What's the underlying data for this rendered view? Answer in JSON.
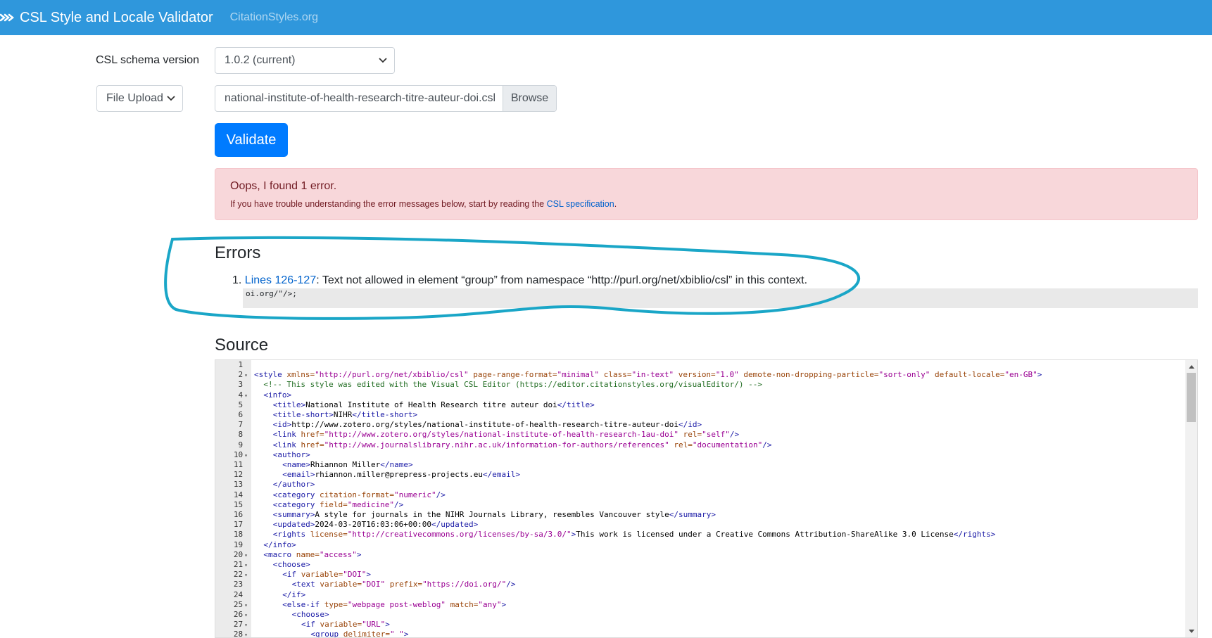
{
  "colors": {
    "nav_bg": "#2f97dc",
    "validate_bg": "#007bff",
    "alert_bg": "#f8d7da",
    "annotation": "#1aa6c7"
  },
  "navbar": {
    "logo_icon": "csl-logo-icon",
    "title": "CSL Style and Locale Validator",
    "link": "CitationStyles.org"
  },
  "form": {
    "schema_label": "CSL schema version",
    "schema_value": "1.0.2 (current)",
    "upload_mode": "File Upload",
    "file_name": "national-institute-of-health-research-titre-auteur-doi.csl",
    "browse_label": "Browse",
    "validate_label": "Validate"
  },
  "alert": {
    "title": "Oops, I found 1 error.",
    "text_before": "If you have trouble understanding the error messages below, start by reading the ",
    "link": "CSL specification",
    "text_after": "."
  },
  "errors": {
    "heading": "Errors",
    "items": [
      {
        "number": "1.",
        "lines_link": "Lines 126-127",
        "message": ": Text not allowed in element “group” from namespace “http://purl.org/net/xbiblio/csl” in this context.",
        "snippet": "oi.org/\"/>;"
      }
    ]
  },
  "source": {
    "heading": "Source",
    "lines": [
      {
        "n": "1",
        "fold": false,
        "indent": 0,
        "t": []
      },
      {
        "n": "2",
        "fold": true,
        "indent": 0,
        "t": [
          [
            "tag",
            "<style "
          ],
          [
            "attr",
            "xmlns="
          ],
          [
            "val",
            "\"http://purl.org/net/xbiblio/csl\""
          ],
          [
            "attr",
            " page-range-format="
          ],
          [
            "val",
            "\"minimal\""
          ],
          [
            "attr",
            " class="
          ],
          [
            "val",
            "\"in-text\""
          ],
          [
            "attr",
            " version="
          ],
          [
            "val",
            "\"1.0\""
          ],
          [
            "attr",
            " demote-non-dropping-particle="
          ],
          [
            "val",
            "\"sort-only\""
          ],
          [
            "attr",
            " default-locale="
          ],
          [
            "val",
            "\"en-GB\""
          ],
          [
            "tag",
            ">"
          ]
        ]
      },
      {
        "n": "3",
        "fold": false,
        "indent": 1,
        "t": [
          [
            "comment",
            "<!-- This style was edited with the Visual CSL Editor (https://editor.citationstyles.org/visualEditor/) -->"
          ]
        ]
      },
      {
        "n": "4",
        "fold": true,
        "indent": 1,
        "t": [
          [
            "tag",
            "<info>"
          ]
        ]
      },
      {
        "n": "5",
        "fold": false,
        "indent": 2,
        "t": [
          [
            "tag",
            "<title>"
          ],
          [
            "text",
            "National Institute of Health Research titre auteur doi"
          ],
          [
            "tag",
            "</title>"
          ]
        ]
      },
      {
        "n": "6",
        "fold": false,
        "indent": 2,
        "t": [
          [
            "tag",
            "<title-short>"
          ],
          [
            "text",
            "NIHR"
          ],
          [
            "tag",
            "</title-short>"
          ]
        ]
      },
      {
        "n": "7",
        "fold": false,
        "indent": 2,
        "t": [
          [
            "tag",
            "<id>"
          ],
          [
            "text",
            "http://www.zotero.org/styles/national-institute-of-health-research-titre-auteur-doi"
          ],
          [
            "tag",
            "</id>"
          ]
        ]
      },
      {
        "n": "8",
        "fold": false,
        "indent": 2,
        "t": [
          [
            "tag",
            "<link "
          ],
          [
            "attr",
            "href="
          ],
          [
            "val",
            "\"http://www.zotero.org/styles/national-institute-of-health-research-1au-doi\""
          ],
          [
            "attr",
            " rel="
          ],
          [
            "val",
            "\"self\""
          ],
          [
            "tag",
            "/>"
          ]
        ]
      },
      {
        "n": "9",
        "fold": false,
        "indent": 2,
        "t": [
          [
            "tag",
            "<link "
          ],
          [
            "attr",
            "href="
          ],
          [
            "val",
            "\"http://www.journalslibrary.nihr.ac.uk/information-for-authors/references\""
          ],
          [
            "attr",
            " rel="
          ],
          [
            "val",
            "\"documentation\""
          ],
          [
            "tag",
            "/>"
          ]
        ]
      },
      {
        "n": "10",
        "fold": true,
        "indent": 2,
        "t": [
          [
            "tag",
            "<author>"
          ]
        ]
      },
      {
        "n": "11",
        "fold": false,
        "indent": 3,
        "t": [
          [
            "tag",
            "<name>"
          ],
          [
            "text",
            "Rhiannon Miller"
          ],
          [
            "tag",
            "</name>"
          ]
        ]
      },
      {
        "n": "12",
        "fold": false,
        "indent": 3,
        "t": [
          [
            "tag",
            "<email>"
          ],
          [
            "text",
            "rhiannon.miller@prepress-projects.eu"
          ],
          [
            "tag",
            "</email>"
          ]
        ]
      },
      {
        "n": "13",
        "fold": false,
        "indent": 2,
        "t": [
          [
            "tag",
            "</author>"
          ]
        ]
      },
      {
        "n": "14",
        "fold": false,
        "indent": 2,
        "t": [
          [
            "tag",
            "<category "
          ],
          [
            "attr",
            "citation-format="
          ],
          [
            "val",
            "\"numeric\""
          ],
          [
            "tag",
            "/>"
          ]
        ]
      },
      {
        "n": "15",
        "fold": false,
        "indent": 2,
        "t": [
          [
            "tag",
            "<category "
          ],
          [
            "attr",
            "field="
          ],
          [
            "val",
            "\"medicine\""
          ],
          [
            "tag",
            "/>"
          ]
        ]
      },
      {
        "n": "16",
        "fold": false,
        "indent": 2,
        "t": [
          [
            "tag",
            "<summary>"
          ],
          [
            "text",
            "A style for journals in the NIHR Journals Library, resembles Vancouver style"
          ],
          [
            "tag",
            "</summary>"
          ]
        ]
      },
      {
        "n": "17",
        "fold": false,
        "indent": 2,
        "t": [
          [
            "tag",
            "<updated>"
          ],
          [
            "text",
            "2024-03-20T16:03:06+00:00"
          ],
          [
            "tag",
            "</updated>"
          ]
        ]
      },
      {
        "n": "18",
        "fold": false,
        "indent": 2,
        "t": [
          [
            "tag",
            "<rights "
          ],
          [
            "attr",
            "license="
          ],
          [
            "val",
            "\"http://creativecommons.org/licenses/by-sa/3.0/\""
          ],
          [
            "tag",
            ">"
          ],
          [
            "text",
            "This work is licensed under a Creative Commons Attribution-ShareAlike 3.0 License"
          ],
          [
            "tag",
            "</rights>"
          ]
        ]
      },
      {
        "n": "19",
        "fold": false,
        "indent": 1,
        "t": [
          [
            "tag",
            "</info>"
          ]
        ]
      },
      {
        "n": "20",
        "fold": true,
        "indent": 1,
        "t": [
          [
            "tag",
            "<macro "
          ],
          [
            "attr",
            "name="
          ],
          [
            "val",
            "\"access\""
          ],
          [
            "tag",
            ">"
          ]
        ]
      },
      {
        "n": "21",
        "fold": true,
        "indent": 2,
        "t": [
          [
            "tag",
            "<choose>"
          ]
        ]
      },
      {
        "n": "22",
        "fold": true,
        "indent": 3,
        "t": [
          [
            "tag",
            "<if "
          ],
          [
            "attr",
            "variable="
          ],
          [
            "val",
            "\"DOI\""
          ],
          [
            "tag",
            ">"
          ]
        ]
      },
      {
        "n": "23",
        "fold": false,
        "indent": 4,
        "t": [
          [
            "tag",
            "<text "
          ],
          [
            "attr",
            "variable="
          ],
          [
            "val",
            "\"DOI\""
          ],
          [
            "attr",
            " prefix="
          ],
          [
            "val",
            "\"https://doi.org/\""
          ],
          [
            "tag",
            "/>"
          ]
        ]
      },
      {
        "n": "24",
        "fold": false,
        "indent": 3,
        "t": [
          [
            "tag",
            "</if>"
          ]
        ]
      },
      {
        "n": "25",
        "fold": true,
        "indent": 3,
        "t": [
          [
            "tag",
            "<else-if "
          ],
          [
            "attr",
            "type="
          ],
          [
            "val",
            "\"webpage post-weblog\""
          ],
          [
            "attr",
            " match="
          ],
          [
            "val",
            "\"any\""
          ],
          [
            "tag",
            ">"
          ]
        ]
      },
      {
        "n": "26",
        "fold": true,
        "indent": 4,
        "t": [
          [
            "tag",
            "<choose>"
          ]
        ]
      },
      {
        "n": "27",
        "fold": true,
        "indent": 5,
        "t": [
          [
            "tag",
            "<if "
          ],
          [
            "attr",
            "variable="
          ],
          [
            "val",
            "\"URL\""
          ],
          [
            "tag",
            ">"
          ]
        ]
      },
      {
        "n": "28",
        "fold": true,
        "indent": 6,
        "t": [
          [
            "tag",
            "<group "
          ],
          [
            "attr",
            "delimiter="
          ],
          [
            "val",
            "\" \""
          ],
          [
            "tag",
            ">"
          ]
        ]
      }
    ]
  }
}
